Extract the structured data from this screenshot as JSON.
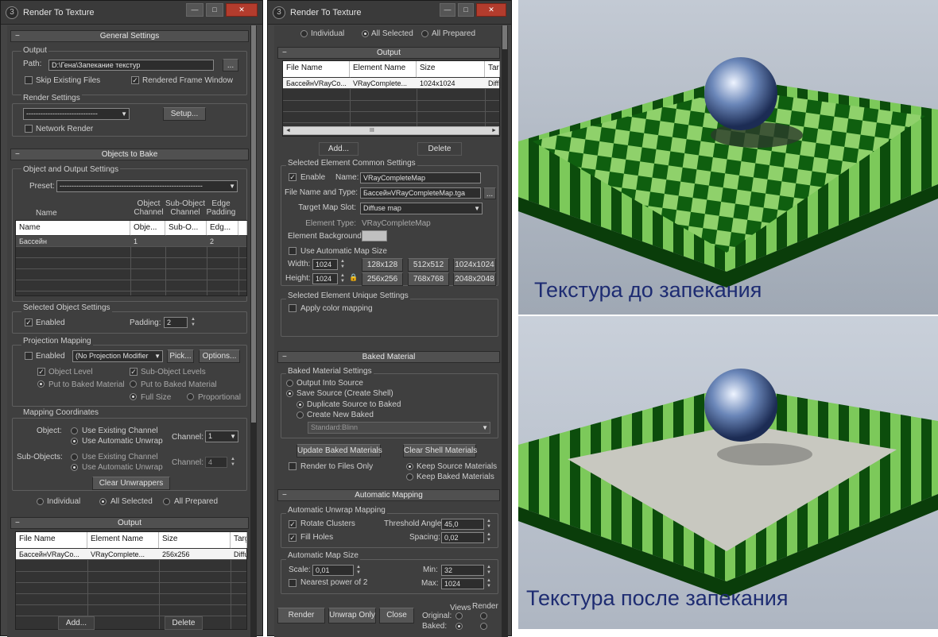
{
  "win1": {
    "title": "Render To Texture",
    "general": {
      "header": "General Settings",
      "output_label": "Output",
      "path_label": "Path:",
      "path_value": "D:\\Гена\\Запекание текстур",
      "browse": "...",
      "skip_existing": "Skip Existing Files",
      "rendered_frame": "Rendered Frame Window",
      "render_settings": "Render Settings",
      "render_preset": "------------------------------",
      "setup": "Setup...",
      "network": "Network Render"
    },
    "objects": {
      "header": "Objects to Bake",
      "group": "Object and Output Settings",
      "preset_label": "Preset:",
      "preset_value": "------------------------------------------------------------",
      "columns_top": [
        "Object Channel",
        "Sub-Object Channel",
        "Edge Padding"
      ],
      "table_header": [
        "Name",
        "Obje...",
        "Sub-O...",
        "Edg..."
      ],
      "rows": [
        [
          "Бассейн",
          "1",
          "",
          "2"
        ]
      ],
      "name_col": "Name"
    },
    "selected": {
      "group": "Selected Object Settings",
      "enabled": "Enabled",
      "padding_label": "Padding:",
      "padding_value": "2"
    },
    "projection": {
      "group": "Projection Mapping",
      "enabled": "Enabled",
      "modifier": "(No Projection Modifier",
      "pick": "Pick...",
      "options": "Options...",
      "object_level": "Object Level",
      "sub_object_levels": "Sub-Object Levels",
      "put_baked_1": "Put to Baked Material",
      "put_baked_2": "Put to Baked Material",
      "full_size": "Full Size",
      "proportional": "Proportional"
    },
    "mapping": {
      "group": "Mapping Coordinates",
      "object_label": "Object:",
      "use_existing": "Use Existing Channel",
      "use_auto": "Use Automatic Unwrap",
      "channel_label": "Channel:",
      "channel_value": "1",
      "sub_label": "Sub-Objects:",
      "sub_use_existing": "Use Existing Channel",
      "sub_use_auto": "Use Automatic Unwrap",
      "sub_channel_label": "Channel:",
      "sub_channel_value": "4",
      "clear": "Clear Unwrappers"
    },
    "scope": {
      "individual": "Individual",
      "all_selected": "All Selected",
      "all_prepared": "All Prepared"
    },
    "output": {
      "header": "Output",
      "table_header": [
        "File Name",
        "Element Name",
        "Size",
        "Targ"
      ],
      "rows": [
        [
          "БассейнVRayCo...",
          "VRayComplete...",
          "256x256",
          "Diffu"
        ]
      ],
      "add": "Add...",
      "delete": "Delete"
    }
  },
  "win2": {
    "title": "Render To Texture",
    "scope": {
      "individual": "Individual",
      "all_selected": "All Selected",
      "all_prepared": "All Prepared"
    },
    "output": {
      "header": "Output",
      "table_header": [
        "File Name",
        "Element Name",
        "Size",
        "Targ"
      ],
      "rows": [
        [
          "БассейнVRayCo...",
          "VRayComplete...",
          "1024x1024",
          "Diffu"
        ]
      ],
      "add": "Add...",
      "delete": "Delete",
      "scroll_mark": "III"
    },
    "element": {
      "group": "Selected Element Common Settings",
      "enable": "Enable",
      "name_label": "Name:",
      "name_value": "VRayCompleteMap",
      "file_label": "File Name and Type:",
      "file_value": "БассейнVRayCompleteMap.tga",
      "browse": "...",
      "slot_label": "Target Map Slot:",
      "slot_value": "Diffuse map",
      "type_label": "Element Type:",
      "type_value": "VRayCompleteMap",
      "bg_label": "Element Background:",
      "auto_size": "Use Automatic Map Size",
      "width_label": "Width:",
      "width_value": "1024",
      "height_label": "Height:",
      "height_value": "1024",
      "sizes": [
        "128x128",
        "512x512",
        "1024x1024",
        "256x256",
        "768x768",
        "2048x2048"
      ]
    },
    "unique": {
      "group": "Selected Element Unique Settings",
      "apply_color": "Apply color mapping"
    },
    "baked": {
      "header": "Baked Material",
      "group": "Baked Material Settings",
      "output_into": "Output Into Source",
      "save_source": "Save Source (Create Shell)",
      "duplicate": "Duplicate Source to Baked",
      "create_new": "Create New Baked",
      "material": "Standard:Blinn",
      "update": "Update Baked Materials",
      "clear_shell": "Clear Shell Materials",
      "render_files": "Render to Files Only",
      "keep_source": "Keep Source Materials",
      "keep_baked": "Keep Baked Materials"
    },
    "auto": {
      "header": "Automatic Mapping",
      "unwrap_group": "Automatic Unwrap Mapping",
      "rotate": "Rotate Clusters",
      "threshold_label": "Threshold Angle:",
      "threshold_value": "45,0",
      "fill": "Fill Holes",
      "spacing_label": "Spacing:",
      "spacing_value": "0,02",
      "size_group": "Automatic Map Size",
      "scale_label": "Scale:",
      "scale_value": "0,01",
      "min_label": "Min:",
      "min_value": "32",
      "nearest": "Nearest power of 2",
      "max_label": "Max:",
      "max_value": "1024"
    },
    "bottom": {
      "render": "Render",
      "unwrap_only": "Unwrap Only",
      "close": "Close",
      "views": "Views",
      "render_col": "Render",
      "original": "Original:",
      "baked": "Baked:"
    }
  },
  "images": {
    "before_caption": "Текстура до запекания",
    "after_caption": "Текстура после запекания"
  }
}
